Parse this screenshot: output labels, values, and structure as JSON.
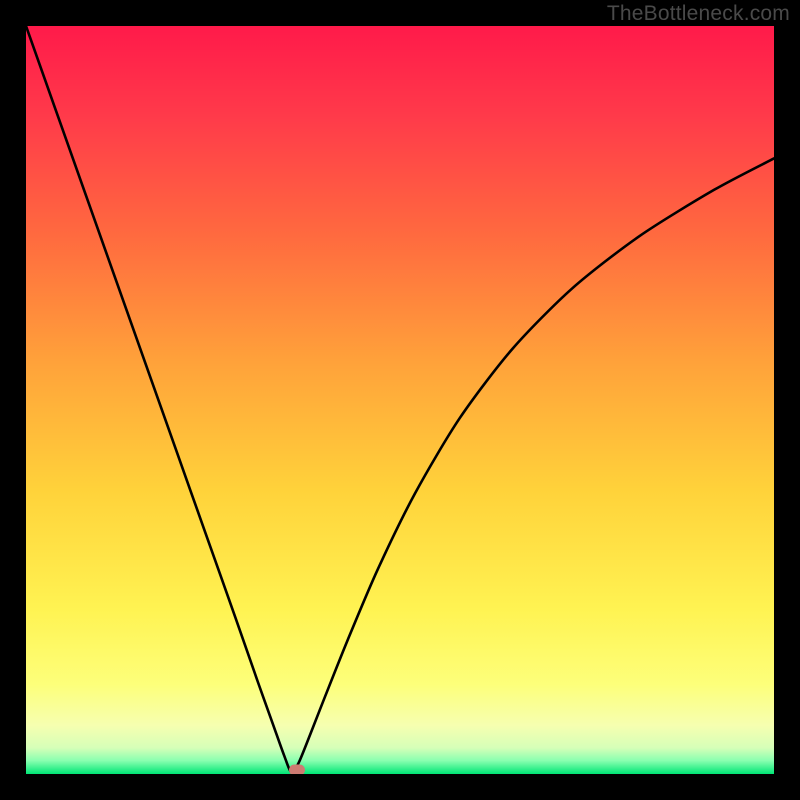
{
  "watermark": "TheBottleneck.com",
  "chart_data": {
    "type": "line",
    "title": "",
    "xlabel": "",
    "ylabel": "",
    "xlim": [
      0,
      100
    ],
    "ylim": [
      0,
      100
    ],
    "series": [
      {
        "name": "bottleneck-curve",
        "x": [
          0,
          4,
          8,
          12,
          16,
          20,
          24,
          28,
          31,
          33,
          34.5,
          35.5,
          36.5,
          38,
          40,
          43,
          47,
          52,
          58,
          65,
          73,
          82,
          92,
          100
        ],
        "y": [
          100,
          88.7,
          77.4,
          66.1,
          54.8,
          43.5,
          32.2,
          20.9,
          12.3,
          6.7,
          2.5,
          0.2,
          1.6,
          5.3,
          10.4,
          17.9,
          27.3,
          37.5,
          47.6,
          56.8,
          64.9,
          71.9,
          78.1,
          82.3
        ]
      }
    ],
    "marker": {
      "name": "optimal-point",
      "x": 36.2,
      "y": 0.5,
      "color": "#cd7b72"
    },
    "gradient_colors": {
      "top": "#ff1a4a",
      "upper_mid": "#ff7a3a",
      "mid": "#ffd23a",
      "lower_mid": "#fffb6a",
      "near_bottom": "#f8ff9a",
      "bottom": "#00e676"
    }
  }
}
